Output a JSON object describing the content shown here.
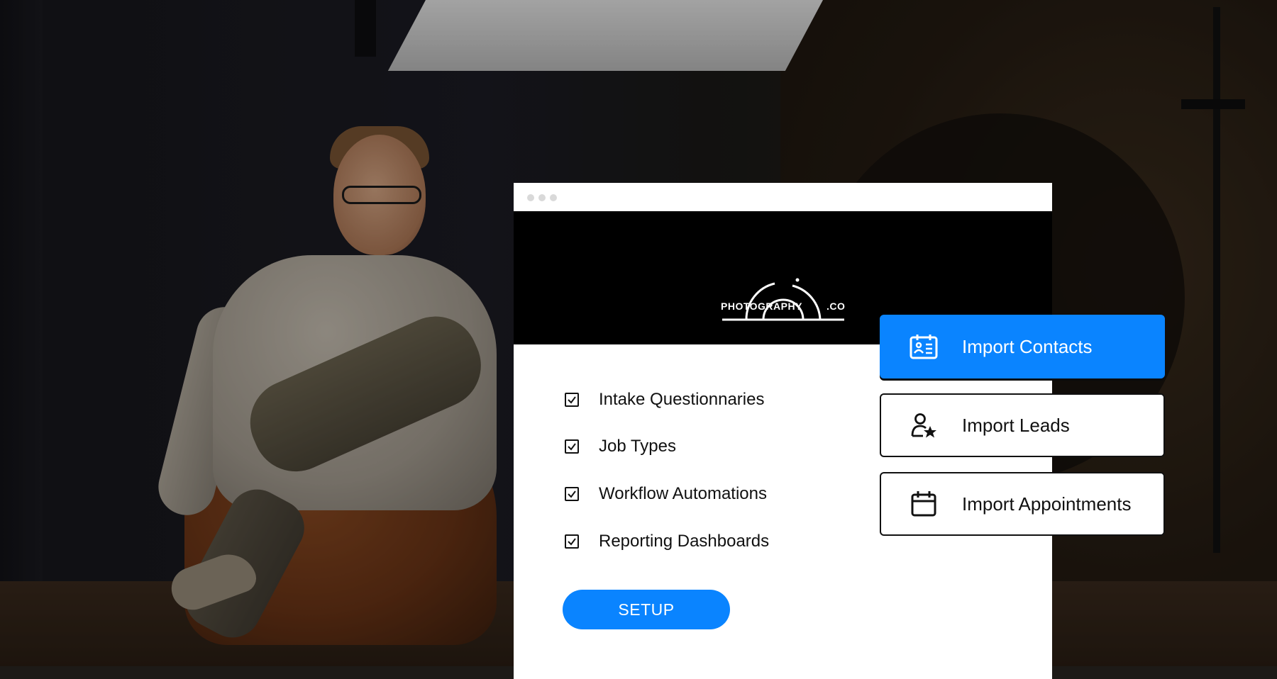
{
  "brand": {
    "name_left": "PHOTOGRAPHY",
    "name_right": ".CO"
  },
  "checklist": {
    "items": [
      {
        "label": "Intake Questionnaries",
        "checked": true
      },
      {
        "label": "Job Types",
        "checked": true
      },
      {
        "label": "Workflow Automations",
        "checked": true
      },
      {
        "label": "Reporting Dashboards",
        "checked": true
      }
    ]
  },
  "setup_button": {
    "label": "SETUP"
  },
  "import_options": [
    {
      "label": "Import Contacts",
      "icon": "contact-card-icon",
      "active": true
    },
    {
      "label": "Import Leads",
      "icon": "user-star-icon",
      "active": false
    },
    {
      "label": "Import Appointments",
      "icon": "calendar-icon",
      "active": false
    }
  ],
  "colors": {
    "accent": "#0a84ff",
    "hero_background": "#000000",
    "text": "#111111"
  }
}
